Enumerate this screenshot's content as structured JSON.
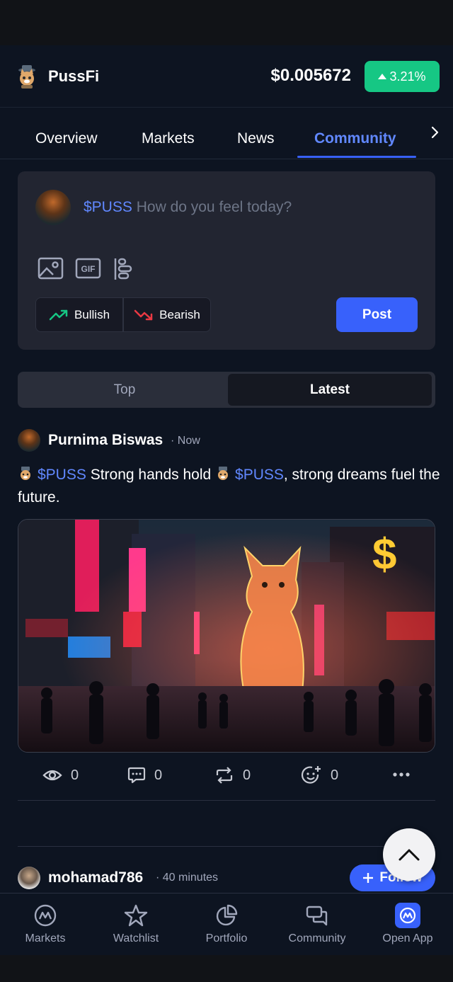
{
  "header": {
    "app_name": "PussFi",
    "price": "$0.005672",
    "change": "3.21%",
    "change_color": "#16c784"
  },
  "tabs": [
    {
      "label": "Overview",
      "active": false
    },
    {
      "label": "Markets",
      "active": false
    },
    {
      "label": "News",
      "active": false
    },
    {
      "label": "Community",
      "active": true
    }
  ],
  "composer": {
    "ticker": "$PUSS",
    "placeholder": "How do you feel today?",
    "icons": [
      "image-icon",
      "gif-icon",
      "poll-icon"
    ],
    "bullish_label": "Bullish",
    "bearish_label": "Bearish",
    "post_label": "Post"
  },
  "sort": {
    "options": [
      "Top",
      "Latest"
    ],
    "selected": "Latest"
  },
  "posts": [
    {
      "author": "Purnima Biswas",
      "time": "· Now",
      "text_parts": [
        "$PUSS",
        " Strong hands hold ",
        "$PUSS",
        ", strong dreams fuel the future."
      ],
      "stats": {
        "views": "0",
        "comments": "0",
        "reposts": "0",
        "reactions": "0"
      }
    },
    {
      "author": "mohamad786",
      "time": "· 40 minutes",
      "follow_label": "Follow"
    }
  ],
  "bottom_nav": [
    {
      "label": "Markets",
      "icon": "markets-icon"
    },
    {
      "label": "Watchlist",
      "icon": "star-icon"
    },
    {
      "label": "Portfolio",
      "icon": "pie-chart-icon"
    },
    {
      "label": "Community",
      "icon": "chat-icon"
    },
    {
      "label": "Open App",
      "icon": "open-app-icon"
    }
  ],
  "colors": {
    "accent": "#3861fb",
    "ticker": "#6188ff",
    "bullish": "#16c784",
    "bearish": "#ea3943",
    "background": "#0d1421"
  }
}
